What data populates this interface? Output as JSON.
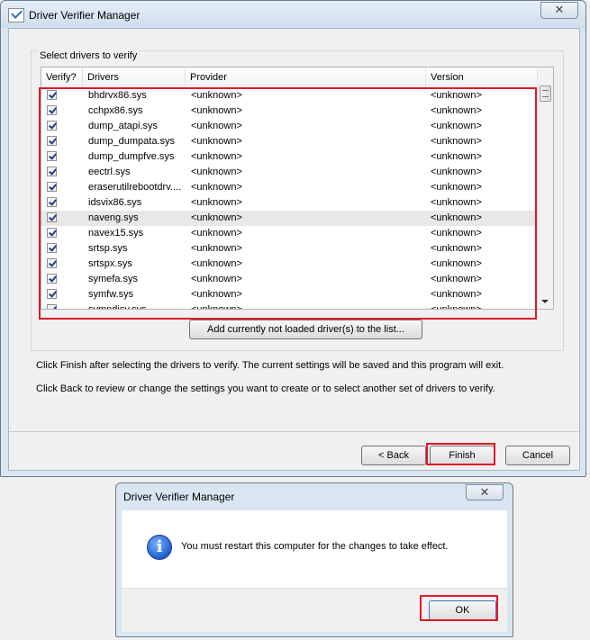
{
  "main_window": {
    "title": "Driver Verifier Manager",
    "close_glyph": "✕",
    "group_label": "Select drivers to verify",
    "columns": [
      "Verify?",
      "Drivers",
      "Provider",
      "Version"
    ],
    "drivers": [
      {
        "name": "bhdrvx86.sys",
        "provider": "<unknown>",
        "version": "<unknown>",
        "checked": true
      },
      {
        "name": "cchpx86.sys",
        "provider": "<unknown>",
        "version": "<unknown>",
        "checked": true
      },
      {
        "name": "dump_atapi.sys",
        "provider": "<unknown>",
        "version": "<unknown>",
        "checked": true
      },
      {
        "name": "dump_dumpata.sys",
        "provider": "<unknown>",
        "version": "<unknown>",
        "checked": true
      },
      {
        "name": "dump_dumpfve.sys",
        "provider": "<unknown>",
        "version": "<unknown>",
        "checked": true
      },
      {
        "name": "eectrl.sys",
        "provider": "<unknown>",
        "version": "<unknown>",
        "checked": true
      },
      {
        "name": "eraserutilrebootdrv....",
        "provider": "<unknown>",
        "version": "<unknown>",
        "checked": true
      },
      {
        "name": "idsvix86.sys",
        "provider": "<unknown>",
        "version": "<unknown>",
        "checked": true
      },
      {
        "name": "naveng.sys",
        "provider": "<unknown>",
        "version": "<unknown>",
        "checked": true,
        "selected": true
      },
      {
        "name": "navex15.sys",
        "provider": "<unknown>",
        "version": "<unknown>",
        "checked": true
      },
      {
        "name": "srtsp.sys",
        "provider": "<unknown>",
        "version": "<unknown>",
        "checked": true
      },
      {
        "name": "srtspx.sys",
        "provider": "<unknown>",
        "version": "<unknown>",
        "checked": true
      },
      {
        "name": "symefa.sys",
        "provider": "<unknown>",
        "version": "<unknown>",
        "checked": true
      },
      {
        "name": "symfw.sys",
        "provider": "<unknown>",
        "version": "<unknown>",
        "checked": true
      },
      {
        "name": "symndisv.sys",
        "provider": "<unknown>",
        "version": "<unknown>",
        "checked": true
      }
    ],
    "add_button": "Add currently not loaded driver(s) to the list...",
    "message1": "Click Finish after selecting the drivers to verify. The current settings will be saved and this program will exit.",
    "message2": "Click Back to review or change the settings you want to create or to select another set of drivers to verify.",
    "back_button": "< Back",
    "finish_button": "Finish",
    "cancel_button": "Cancel"
  },
  "dialog": {
    "title": "Driver Verifier Manager",
    "close_glyph": "✕",
    "icon_glyph": "i",
    "message": "You must restart this computer for the changes to take effect.",
    "ok_button": "OK"
  },
  "colors": {
    "highlight_box": "#e0182a",
    "window_frame": "#d9e6f2"
  },
  "icons": [
    "app-icon",
    "close-icon",
    "checkbox-checked-icon",
    "scroll-down-icon",
    "info-icon"
  ]
}
